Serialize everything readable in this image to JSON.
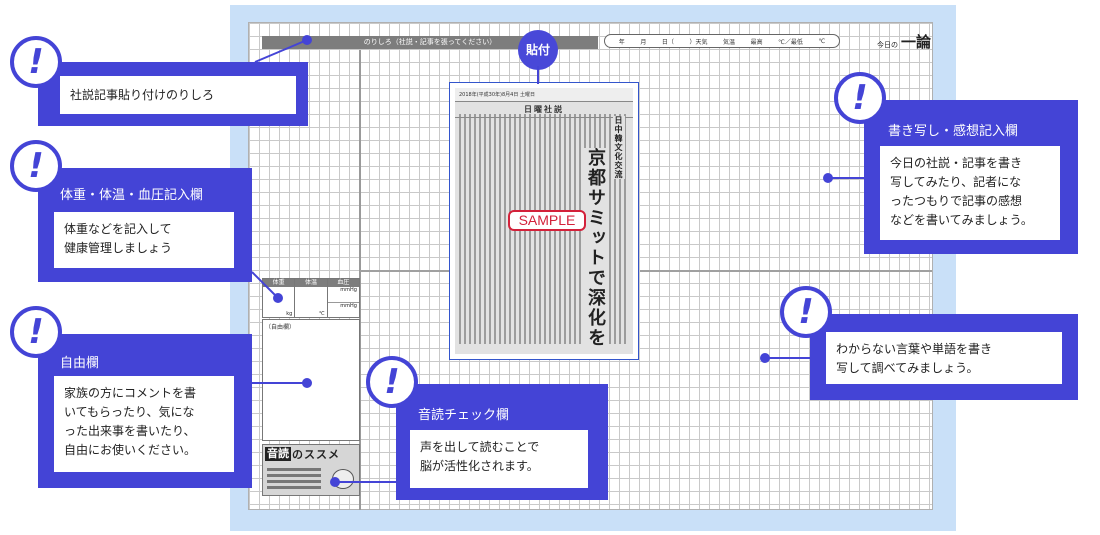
{
  "sheet": {
    "paste_area_label": "のりしろ（社説・記事を張ってください）",
    "date_box": [
      "年",
      "月",
      "日（",
      "）天気",
      "気温",
      "最高",
      "℃／最低",
      "℃"
    ],
    "logo_small": "今日の",
    "logo_big": "一論",
    "stats": {
      "weight_header": "体重",
      "temp_header": "体温",
      "bp_header": "血圧",
      "weight_unit": "kg",
      "temp_unit": "℃",
      "bp_units": [
        "mmHg",
        "mmHg"
      ]
    },
    "free_label": "（自由欄）",
    "ondoku": {
      "title_a": "音読",
      "title_b": "のススメ"
    }
  },
  "clipping": {
    "header_line": "2018年(平成30年)8月4日 土曜日",
    "column_title": "日曜社説",
    "headline_small": "日中韓文化交流",
    "headline_big": "京都サミットで深化を",
    "sample": "SAMPLE"
  },
  "paste_badge": "貼付",
  "callouts": {
    "paste": {
      "body": "社説記事貼り付けのりしろ"
    },
    "body_stats": {
      "title": "体重・体温・血圧記入欄",
      "body": [
        "体重などを記入して",
        "健康管理しましょう"
      ]
    },
    "free": {
      "title": "自由欄",
      "body": [
        "家族の方にコメントを書",
        "いてもらったり、気にな",
        "った出来事を書いたり、",
        "自由にお使いください。"
      ]
    },
    "ondoku": {
      "title": "音読チェック欄",
      "body": [
        "声を出して読むことで",
        "脳が活性化されます。"
      ]
    },
    "copy": {
      "title": "書き写し・感想記入欄",
      "body": [
        "今日の社説・記事を書き",
        "写してみたり、記者にな",
        "ったつもりで記事の感想",
        "などを書いてみましょう。"
      ]
    },
    "words": {
      "body": [
        "わからない言葉や単語を書き",
        "写して調べてみましょう。"
      ]
    }
  },
  "colors": {
    "accent": "#4444d6",
    "backdrop": "#c9e0f8",
    "stamp": "#d3213a"
  }
}
